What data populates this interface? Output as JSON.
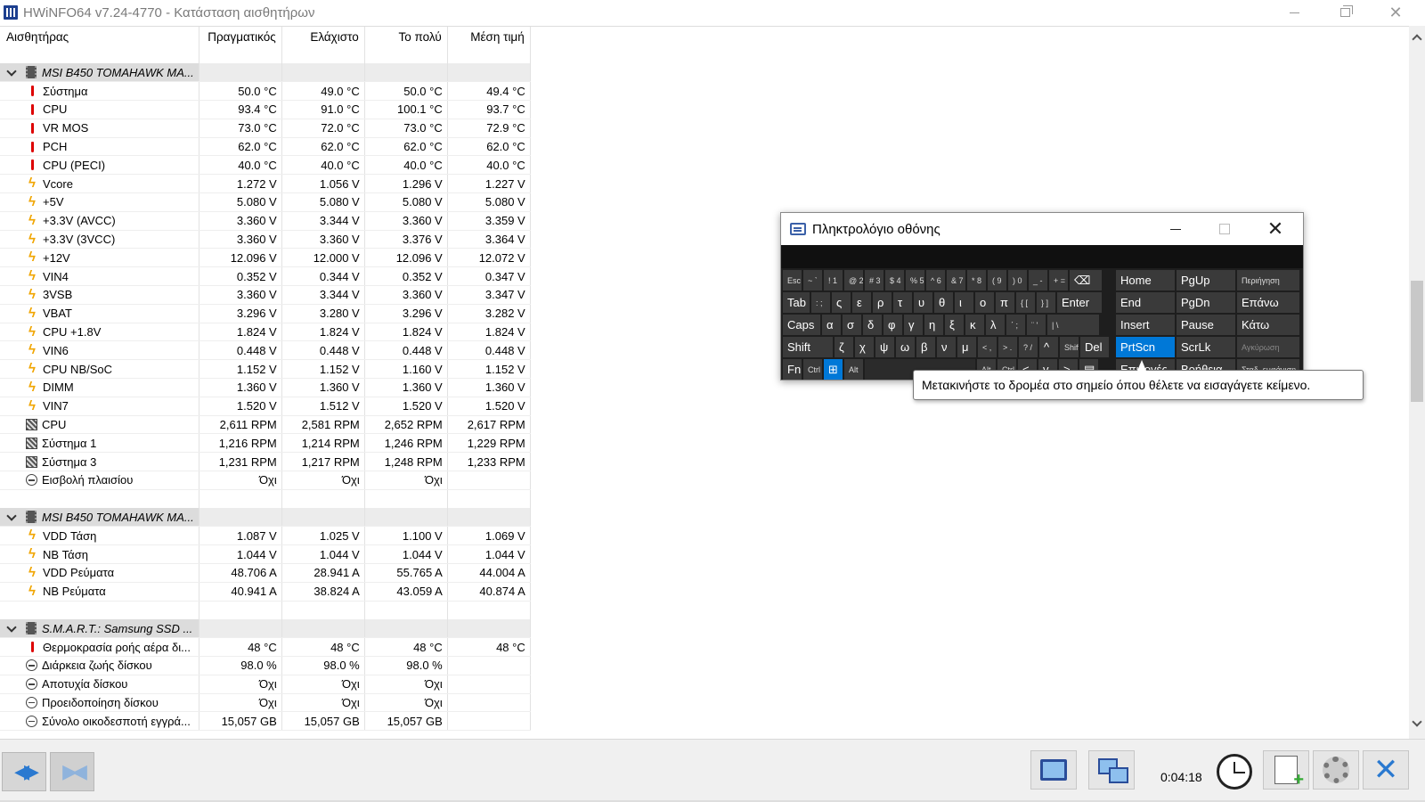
{
  "window": {
    "title": "HWiNFO64 v7.24-4770 - Κατάσταση αισθητήρων"
  },
  "table": {
    "headers": [
      "Αισθητήρας",
      "Πραγματικός",
      "Ελάχιστο",
      "Το πολύ",
      "Μέση τιμή"
    ],
    "groups": [
      {
        "title": "MSI B450 TOMAHAWK MA...",
        "rows": [
          {
            "icon": "temp",
            "name": "Σύστημα",
            "cur": "50.0 °C",
            "min": "49.0 °C",
            "max": "50.0 °C",
            "avg": "49.4 °C"
          },
          {
            "icon": "temp",
            "name": "CPU",
            "cur": "93.4 °C",
            "min": "91.0 °C",
            "max": "100.1 °C",
            "avg": "93.7 °C"
          },
          {
            "icon": "temp",
            "name": "VR MOS",
            "cur": "73.0 °C",
            "min": "72.0 °C",
            "max": "73.0 °C",
            "avg": "72.9 °C"
          },
          {
            "icon": "temp",
            "name": "PCH",
            "cur": "62.0 °C",
            "min": "62.0 °C",
            "max": "62.0 °C",
            "avg": "62.0 °C"
          },
          {
            "icon": "temp",
            "name": "CPU (PECI)",
            "cur": "40.0 °C",
            "min": "40.0 °C",
            "max": "40.0 °C",
            "avg": "40.0 °C"
          },
          {
            "icon": "volt",
            "name": "Vcore",
            "cur": "1.272 V",
            "min": "1.056 V",
            "max": "1.296 V",
            "avg": "1.227 V"
          },
          {
            "icon": "volt",
            "name": "+5V",
            "cur": "5.080 V",
            "min": "5.080 V",
            "max": "5.080 V",
            "avg": "5.080 V"
          },
          {
            "icon": "volt",
            "name": "+3.3V (AVCC)",
            "cur": "3.360 V",
            "min": "3.344 V",
            "max": "3.360 V",
            "avg": "3.359 V"
          },
          {
            "icon": "volt",
            "name": "+3.3V (3VCC)",
            "cur": "3.360 V",
            "min": "3.360 V",
            "max": "3.376 V",
            "avg": "3.364 V"
          },
          {
            "icon": "volt",
            "name": "+12V",
            "cur": "12.096 V",
            "min": "12.000 V",
            "max": "12.096 V",
            "avg": "12.072 V"
          },
          {
            "icon": "volt",
            "name": "VIN4",
            "cur": "0.352 V",
            "min": "0.344 V",
            "max": "0.352 V",
            "avg": "0.347 V"
          },
          {
            "icon": "volt",
            "name": "3VSB",
            "cur": "3.360 V",
            "min": "3.344 V",
            "max": "3.360 V",
            "avg": "3.347 V"
          },
          {
            "icon": "volt",
            "name": "VBAT",
            "cur": "3.296 V",
            "min": "3.280 V",
            "max": "3.296 V",
            "avg": "3.282 V"
          },
          {
            "icon": "volt",
            "name": "CPU +1.8V",
            "cur": "1.824 V",
            "min": "1.824 V",
            "max": "1.824 V",
            "avg": "1.824 V"
          },
          {
            "icon": "volt",
            "name": "VIN6",
            "cur": "0.448 V",
            "min": "0.448 V",
            "max": "0.448 V",
            "avg": "0.448 V"
          },
          {
            "icon": "volt",
            "name": "CPU NB/SoC",
            "cur": "1.152 V",
            "min": "1.152 V",
            "max": "1.160 V",
            "avg": "1.152 V"
          },
          {
            "icon": "volt",
            "name": "DIMM",
            "cur": "1.360 V",
            "min": "1.360 V",
            "max": "1.360 V",
            "avg": "1.360 V"
          },
          {
            "icon": "volt",
            "name": "VIN7",
            "cur": "1.520 V",
            "min": "1.512 V",
            "max": "1.520 V",
            "avg": "1.520 V"
          },
          {
            "icon": "fan",
            "name": "CPU",
            "cur": "2,611 RPM",
            "min": "2,581 RPM",
            "max": "2,652 RPM",
            "avg": "2,617 RPM"
          },
          {
            "icon": "fan",
            "name": "Σύστημα 1",
            "cur": "1,216 RPM",
            "min": "1,214 RPM",
            "max": "1,246 RPM",
            "avg": "1,229 RPM"
          },
          {
            "icon": "fan",
            "name": "Σύστημα 3",
            "cur": "1,231 RPM",
            "min": "1,217 RPM",
            "max": "1,248 RPM",
            "avg": "1,233 RPM"
          },
          {
            "icon": "other",
            "name": "Εισβολή πλαισίου",
            "cur": "Όχι",
            "min": "Όχι",
            "max": "Όχι",
            "avg": ""
          }
        ]
      },
      {
        "title": "MSI B450 TOMAHAWK MA...",
        "rows": [
          {
            "icon": "volt",
            "name": "VDD Τάση",
            "cur": "1.087 V",
            "min": "1.025 V",
            "max": "1.100 V",
            "avg": "1.069 V"
          },
          {
            "icon": "volt",
            "name": "NB Τάση",
            "cur": "1.044 V",
            "min": "1.044 V",
            "max": "1.044 V",
            "avg": "1.044 V"
          },
          {
            "icon": "volt",
            "name": "VDD Ρεύματα",
            "cur": "48.706 A",
            "min": "28.941 A",
            "max": "55.765 A",
            "avg": "44.004 A"
          },
          {
            "icon": "volt",
            "name": "NB Ρεύματα",
            "cur": "40.941 A",
            "min": "38.824 A",
            "max": "43.059 A",
            "avg": "40.874 A"
          }
        ]
      },
      {
        "title": "S.M.A.R.T.: Samsung SSD ...",
        "rows": [
          {
            "icon": "temp",
            "name": "Θερμοκρασία ροής αέρα δι...",
            "cur": "48 °C",
            "min": "48 °C",
            "max": "48 °C",
            "avg": "48 °C"
          },
          {
            "icon": "other",
            "name": "Διάρκεια ζωής δίσκου",
            "cur": "98.0 %",
            "min": "98.0 %",
            "max": "98.0 %",
            "avg": ""
          },
          {
            "icon": "other",
            "name": "Αποτυχία δίσκου",
            "cur": "Όχι",
            "min": "Όχι",
            "max": "Όχι",
            "avg": ""
          },
          {
            "icon": "other",
            "name": "Προειδοποίηση δίσκου",
            "cur": "Όχι",
            "min": "Όχι",
            "max": "Όχι",
            "avg": ""
          },
          {
            "icon": "other",
            "name": "Σύνολο οικοδεσποτή εγγρά...",
            "cur": "15,057 GB",
            "min": "15,057 GB",
            "max": "15,057 GB",
            "avg": ""
          }
        ]
      }
    ]
  },
  "toolbar": {
    "timer": "0:04:18"
  },
  "osk": {
    "title": "Πληκτρολόγιο οθόνης",
    "keys": [
      {
        "label": "Esc",
        "small": true
      },
      {
        "label": "~ `",
        "small": true
      },
      {
        "label": "! 1",
        "small": true
      },
      {
        "label": "@ 2",
        "small": true
      },
      {
        "label": "# 3",
        "small": true
      },
      {
        "label": "$ 4",
        "small": true
      },
      {
        "label": "% 5",
        "small": true
      },
      {
        "label": "^ 6",
        "small": true
      },
      {
        "label": "& 7",
        "small": true
      },
      {
        "label": "* 8",
        "small": true
      },
      {
        "label": "( 9",
        "small": true
      },
      {
        "label": ") 0",
        "small": true
      },
      {
        "label": "_ -",
        "small": true
      },
      {
        "label": "+ =",
        "small": true
      },
      {
        "label": "⌫"
      },
      {
        "label": "Tab"
      },
      {
        "label": ": ;",
        "small": true
      },
      {
        "label": "ς"
      },
      {
        "label": "ε"
      },
      {
        "label": "ρ"
      },
      {
        "label": "τ"
      },
      {
        "label": "υ"
      },
      {
        "label": "θ"
      },
      {
        "label": "ι"
      },
      {
        "label": "ο"
      },
      {
        "label": "π"
      },
      {
        "label": "{ [",
        "small": true
      },
      {
        "label": "} ]",
        "small": true
      },
      {
        "label": "Enter"
      },
      {
        "label": "Caps"
      },
      {
        "label": "α"
      },
      {
        "label": "σ"
      },
      {
        "label": "δ"
      },
      {
        "label": "φ"
      },
      {
        "label": "γ"
      },
      {
        "label": "η"
      },
      {
        "label": "ξ"
      },
      {
        "label": "κ"
      },
      {
        "label": "λ"
      },
      {
        "label": "΄ ;",
        "small": true
      },
      {
        "label": "¨ '",
        "small": true
      },
      {
        "label": "| \\",
        "small": true
      },
      {
        "label": "Shift"
      },
      {
        "label": "ζ"
      },
      {
        "label": "χ"
      },
      {
        "label": "ψ"
      },
      {
        "label": "ω"
      },
      {
        "label": "β"
      },
      {
        "label": "ν"
      },
      {
        "label": "μ"
      },
      {
        "label": "< ,",
        "small": true
      },
      {
        "label": "> .",
        "small": true
      },
      {
        "label": "? /",
        "small": true
      },
      {
        "label": "^"
      },
      {
        "label": "Shift",
        "small": true
      },
      {
        "label": "Del"
      },
      {
        "label": "Fn"
      },
      {
        "label": "Ctrl",
        "small": true
      },
      {
        "label": "⊞"
      },
      {
        "label": "Alt",
        "small": true
      },
      {
        "label": ""
      },
      {
        "label": "Alt",
        "small": true
      },
      {
        "label": "Ctrl",
        "small": true
      },
      {
        "label": "<"
      },
      {
        "label": "v"
      },
      {
        "label": ">"
      },
      {
        "label": "▤"
      },
      {
        "label": "Home"
      },
      {
        "label": "PgUp"
      },
      {
        "label": "Περιήγηση",
        "small": true
      },
      {
        "label": "End"
      },
      {
        "label": "PgDn"
      },
      {
        "label": "Επάνω"
      },
      {
        "label": "Insert"
      },
      {
        "label": "Pause"
      },
      {
        "label": "Κάτω"
      },
      {
        "label": "PrtScn"
      },
      {
        "label": "ScrLk"
      },
      {
        "label": "Αγκύρωση",
        "small": true
      },
      {
        "label": "Επιλογές"
      },
      {
        "label": "Βοήθεια"
      },
      {
        "label": "Σταδ. εμφάνιση",
        "small": true
      }
    ]
  },
  "tooltip": {
    "text": "Μετακινήστε το δρομέα στο σημείο όπου θέλετε να εισαγάγετε κείμενο."
  }
}
